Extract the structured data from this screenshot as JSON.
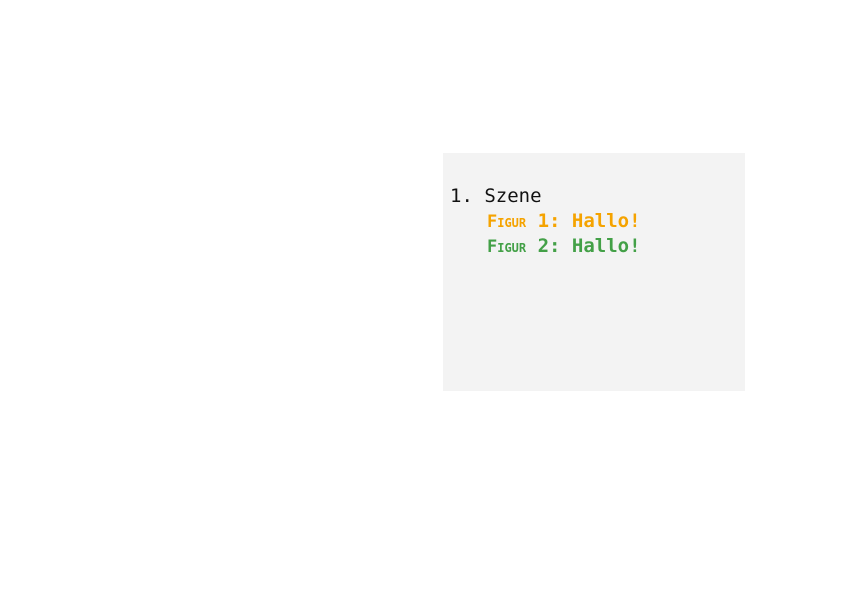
{
  "panel": {
    "scene": {
      "number": "1.",
      "title": "Szene"
    },
    "dialogue": [
      {
        "speaker_word": "Figur",
        "speaker_rest": " 1: Hallo!",
        "color": "#f5a300"
      },
      {
        "speaker_word": "Figur",
        "speaker_rest": " 2: Hallo!",
        "color": "#43a047"
      }
    ]
  }
}
